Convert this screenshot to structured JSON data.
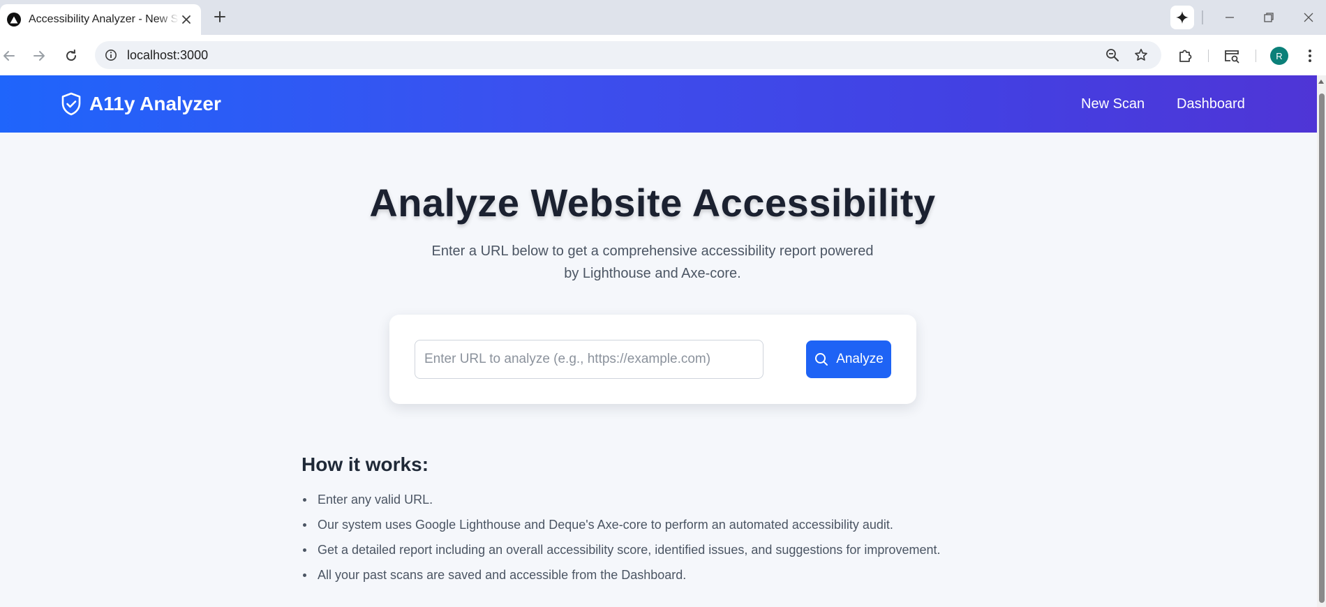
{
  "browser": {
    "tab_title": "Accessibility Analyzer - New Scan",
    "url": "localhost:3000",
    "profile_initial": "R"
  },
  "icons": {
    "tab_favicon": "triangle-logo-icon",
    "tab_close": "close-icon",
    "new_tab": "plus-icon",
    "gemini": "sparkle-icon",
    "minimize": "minimize-icon",
    "restore": "restore-icon",
    "close_window": "close-icon",
    "back": "arrow-left-icon",
    "forward": "arrow-right-icon",
    "reload": "reload-icon",
    "site_info": "info-icon",
    "zoom": "zoom-out-icon",
    "bookmark": "star-icon",
    "extensions": "puzzle-icon",
    "tab_search": "tab-search-icon",
    "menu": "kebab-menu-icon",
    "brand": "shield-check-icon",
    "analyze": "search-icon"
  },
  "colors": {
    "header_gradient_start": "#1f65fb",
    "header_gradient_end": "#4f35d6",
    "primary_button": "#1e63f5",
    "avatar": "#0b8079"
  },
  "app": {
    "brand_name": "A11y Analyzer",
    "nav": [
      "New Scan",
      "Dashboard"
    ]
  },
  "hero": {
    "title": "Analyze Website Accessibility",
    "subtitle": "Enter a URL below to get a comprehensive accessibility report powered by Lighthouse and Axe-core."
  },
  "scan_form": {
    "input_value": "",
    "input_placeholder": "Enter URL to analyze (e.g., https://example.com)",
    "button_label": "Analyze"
  },
  "how_it_works": {
    "title": "How it works:",
    "steps": [
      "Enter any valid URL.",
      "Our system uses Google Lighthouse and Deque's Axe-core to perform an automated accessibility audit.",
      "Get a detailed report including an overall accessibility score, identified issues, and suggestions for improvement.",
      "All your past scans are saved and accessible from the Dashboard."
    ]
  }
}
